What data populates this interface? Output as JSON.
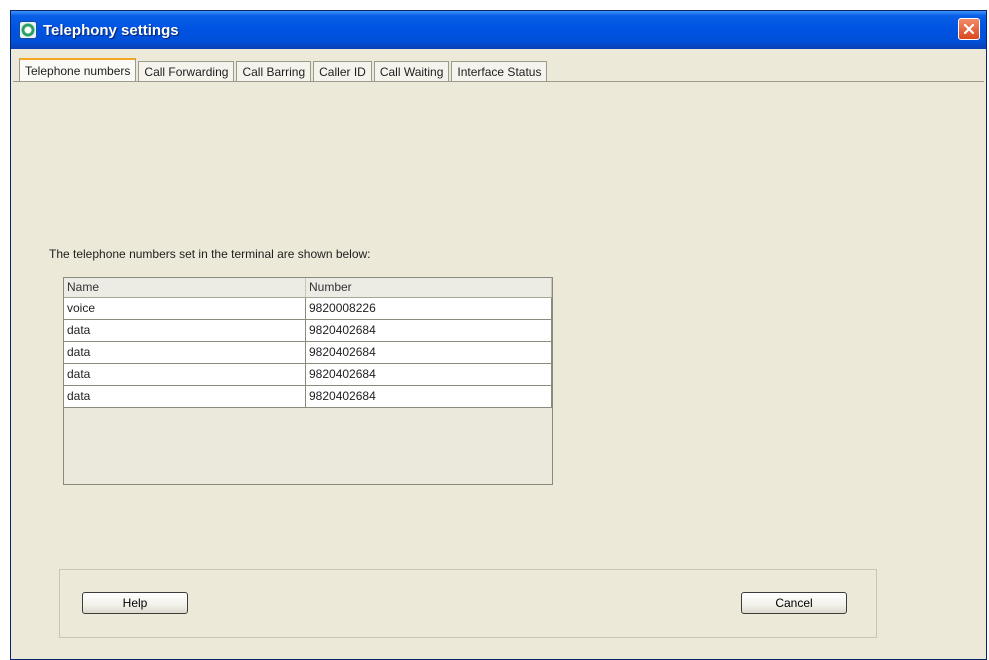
{
  "window": {
    "title": "Telephony settings",
    "close_icon": "close-icon"
  },
  "tabs": [
    {
      "label": "Telephone numbers",
      "active": true
    },
    {
      "label": "Call Forwarding",
      "active": false
    },
    {
      "label": "Call Barring",
      "active": false
    },
    {
      "label": "Caller ID",
      "active": false
    },
    {
      "label": "Call Waiting",
      "active": false
    },
    {
      "label": "Interface Status",
      "active": false
    }
  ],
  "content": {
    "intro": "The telephone numbers set in the terminal are shown below:",
    "table": {
      "columns": [
        "Name",
        "Number"
      ],
      "rows": [
        [
          "voice",
          "9820008226"
        ],
        [
          "data",
          "9820402684"
        ],
        [
          "data",
          "9820402684"
        ],
        [
          "data",
          "9820402684"
        ],
        [
          "data",
          "9820402684"
        ]
      ]
    }
  },
  "buttons": {
    "help": "Help",
    "cancel": "Cancel"
  },
  "colors": {
    "titlebar": "#0054e3",
    "close": "#d9491f",
    "active_tab_accent": "#f5a623",
    "background": "#ece9d8"
  }
}
